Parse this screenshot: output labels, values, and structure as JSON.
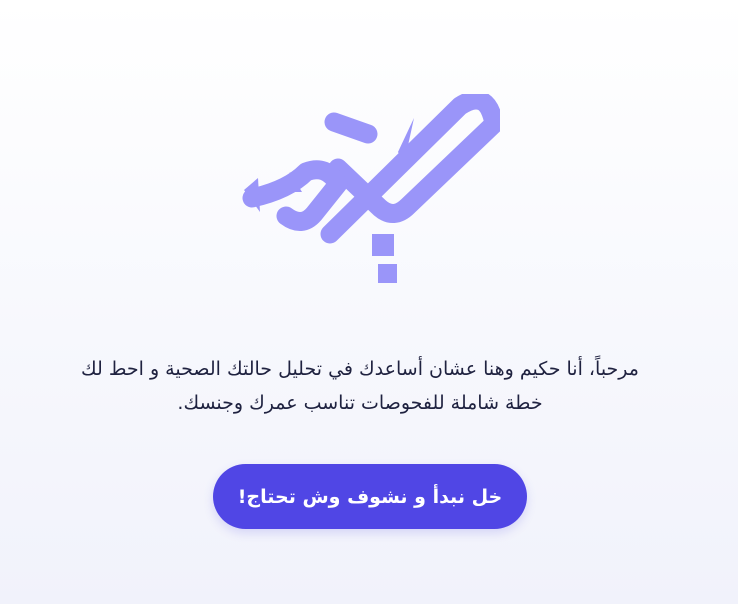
{
  "intro": {
    "text": "مرحباً، أنا حكيم وهنا عشان أساعدك في تحليل حالتك الصحية و احط لك خطة شاملة للفحوصات تناسب عمرك وجنسك."
  },
  "start_button": {
    "label": "خل نبدأ و نشوف وش تحتاج!"
  },
  "colors": {
    "logo": "#9a95f9",
    "button": "#5046e5",
    "text": "#1f2240"
  },
  "logo": {
    "icon": "hakeem-calligraphy-logo"
  }
}
